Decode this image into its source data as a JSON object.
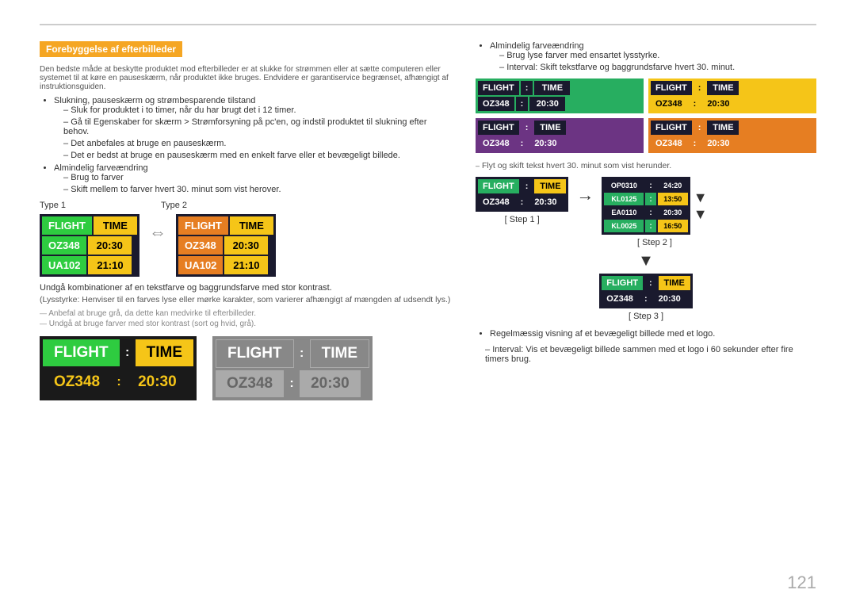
{
  "page": {
    "number": "121",
    "top_rule": true
  },
  "section": {
    "title": "Forebyggelse af efterbilleder"
  },
  "notes": {
    "note1": "Den bedste måde at beskytte produktet mod efterbilleder er at slukke for strømmen eller at sætte computeren eller systemet til at køre en pauseskærm, når produktet ikke bruges. Endvidere er garantiservice begrænset, afhængigt af instruktionsguiden.",
    "bullet1": "Slukning, pauseskærm og strømbesparende tilstand",
    "sub1a": "Sluk for produktet i to timer, når du har brugt det i 12 timer.",
    "sub1b": "Gå til Egenskaber for skærm > Strømforsyning på pc'en, og indstil produktet til slukning efter behov.",
    "sub1c": "Det anbefales at bruge en pauseskærm.",
    "sub1d": "Det er bedst at bruge en pauseskærm med en enkelt farve eller et bevægeligt billede.",
    "bullet2": "Almindelig farveændring",
    "sub2a": "Brug to farver",
    "sub2b": "Skift mellem to farver hvert 30. minut som vist herover.",
    "type1": "Type 1",
    "type2": "Type 2",
    "contrast_note": "Undgå kombinationer af en tekstfarve og baggrundsfarve med stor kontrast.",
    "contrast_sub": "(Lysstyrke: Henviser til en farves lyse eller mørke karakter, som varierer afhængigt af mængden af udsendt lys.)",
    "grey1": "Anbefal at bruge grå, da dette kan medvirke til efterbilleder.",
    "grey2": "Undgå at bruge farver med stor kontrast (sort og hvid, grå).",
    "right_note1": "Almindelig farveændring",
    "right_sub1a": "Brug lyse farver med ensartet lysstyrke.",
    "right_sub1b": "Interval: Skift tekstfarve og baggrundsfarve hvert 30. minut.",
    "step_note": "Flyt og skift tekst hvert 30. minut som vist herunder.",
    "step1_label": "[ Step 1 ]",
    "step2_label": "[ Step 2 ]",
    "step3_label": "[ Step 3 ]",
    "bottom_note1": "Regelmæssig visning af et bevægeligt billede med et logo.",
    "bottom_note2": "Interval: Vis et bevægeligt billede sammen med et logo i 60 sekunder efter fire timers brug."
  },
  "boards": {
    "flight": "FLIGHT",
    "colon": ":",
    "time": "TIME",
    "oz348": "OZ348",
    "time_val": "20:30",
    "ua102": "UA102",
    "time2": "21:10",
    "scroll_rows": [
      {
        "flight": "OP0310",
        "colon": ":",
        "time": "24:20"
      },
      {
        "flight": "KL0125",
        "colon": ":",
        "time": "13:50"
      },
      {
        "flight": "EA0110",
        "colon": ":",
        "time": "20:30"
      },
      {
        "flight": "KL0025",
        "colon": ":",
        "time": "16:50"
      }
    ]
  }
}
